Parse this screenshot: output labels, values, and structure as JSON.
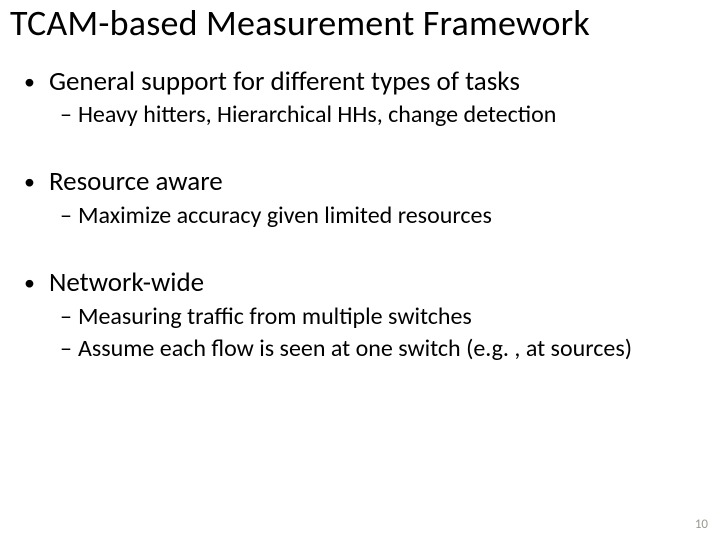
{
  "title": "TCAM-based Measurement Framework",
  "bullets": [
    {
      "text": "General support for different types of tasks",
      "sub": [
        "Heavy hitters, Hierarchical HHs, change detection"
      ]
    },
    {
      "text": "Resource aware",
      "sub": [
        "Maximize accuracy given limited resources"
      ]
    },
    {
      "text": "Network-wide",
      "sub": [
        "Measuring traffic from multiple switches",
        "Assume each flow is seen at one switch (e.g. , at sources)"
      ]
    }
  ],
  "page_number": "10"
}
